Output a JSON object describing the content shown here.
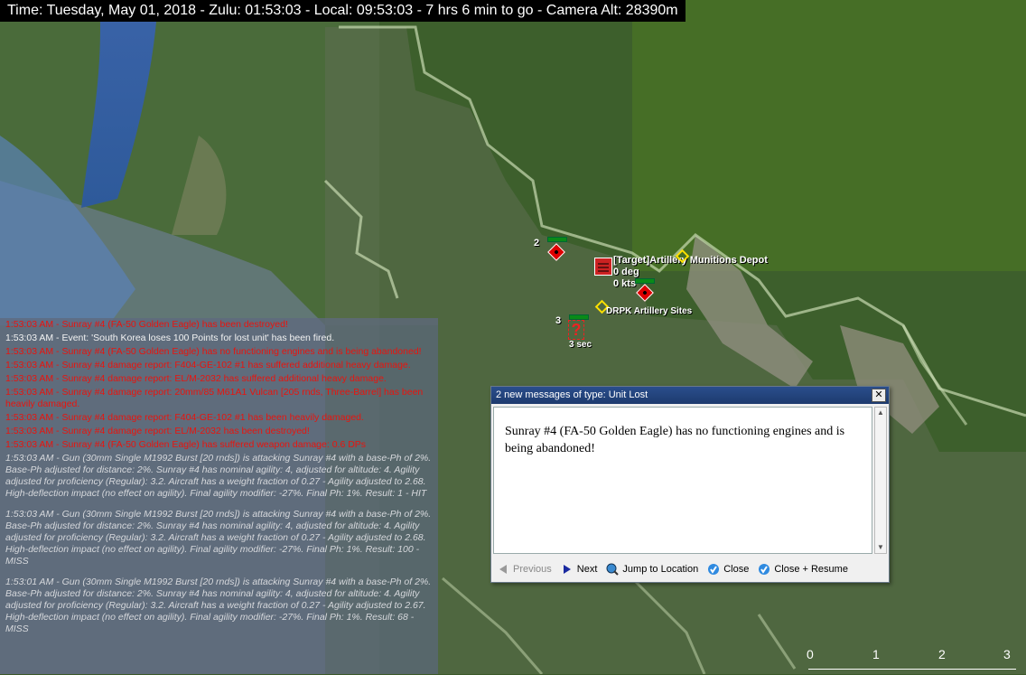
{
  "status_bar": {
    "text": "Time: Tuesday, May 01, 2018 - Zulu: 01:53:03 - Local: 09:53:03 - 7 hrs 6 min to go -  Camera Alt: 28390m"
  },
  "map": {
    "units": [
      {
        "label": "2"
      },
      {
        "label": "3"
      }
    ],
    "target_label": "[Target]Artillery Munitions Depot",
    "target_heading": "0 deg",
    "target_speed": "0 kts",
    "site_label": "DRPK Artillery Sites",
    "timer_label": "3 sec"
  },
  "log": {
    "entries": [
      {
        "color": "red",
        "text": "1:53:03 AM - Sunray #4 (FA-50 Golden Eagle) has been destroyed!"
      },
      {
        "color": "white",
        "text": "1:53:03 AM - Event: 'South Korea loses 100 Points for lost unit' has been fired."
      },
      {
        "color": "red",
        "text": "1:53:03 AM - Sunray #4 (FA-50 Golden Eagle) has no functioning engines and is being abandoned!"
      },
      {
        "color": "red",
        "text": "1:53:03 AM - Sunray #4 damage report: F404-GE-102 #1 has suffered additional heavy damage."
      },
      {
        "color": "red",
        "text": "1:53:03 AM - Sunray #4 damage report: EL/M-2032 has suffered additional heavy damage."
      },
      {
        "color": "red",
        "text": "1:53:03 AM - Sunray #4 damage report: 20mm/85 M61A1 Vulcan [205 rnds, Three-Barrel] has been heavily damaged."
      },
      {
        "color": "red",
        "text": "1:53:03 AM - Sunray #4 damage report: F404-GE-102 #1 has been heavily damaged."
      },
      {
        "color": "red",
        "text": "1:53:03 AM - Sunray #4 damage report: EL/M-2032 has been destroyed!"
      },
      {
        "color": "red",
        "text": "1:53:03 AM - Sunray #4 (FA-50 Golden Eagle) has suffered weapon damage: 0.6 DPs"
      },
      {
        "color": "grey",
        "text": "1:53:03 AM - Gun (30mm Single M1992 Burst [20 rnds]) is attacking Sunray #4 with a base-Ph of 2%. Base-Ph adjusted for distance: 2%. Sunray #4 has nominal agility: 4, adjusted for altitude: 4. Agility adjusted for proficiency (Regular): 3.2. Aircraft has a weight fraction of 0.27 - Agility adjusted to 2.68. High-deflection impact (no effect on agility). Final agility modifier: -27%. Final Ph: 1%. Result: 1 - HIT"
      },
      {
        "color": "grey",
        "text": "1:53:03 AM - Gun (30mm Single M1992 Burst [20 rnds]) is attacking Sunray #4 with a base-Ph of 2%. Base-Ph adjusted for distance: 2%. Sunray #4 has nominal agility: 4, adjusted for altitude: 4. Agility adjusted for proficiency (Regular): 3.2. Aircraft has a weight fraction of 0.27 - Agility adjusted to 2.68. High-deflection impact (no effect on agility). Final agility modifier: -27%. Final Ph: 1%. Result: 100 - MISS"
      },
      {
        "color": "grey",
        "text": "1:53:01 AM - Gun (30mm Single M1992 Burst [20 rnds]) is attacking Sunray #4 with a base-Ph of 2%. Base-Ph adjusted for distance: 2%. Sunray #4 has nominal agility: 4, adjusted for altitude: 4. Agility adjusted for proficiency (Regular): 3.2. Aircraft has a weight fraction of 0.27 - Agility adjusted to 2.67. High-deflection impact (no effect on agility). Final agility modifier: -27%. Final Ph: 1%. Result: 68 - MISS"
      }
    ]
  },
  "dialog": {
    "title": "2 new messages of type: Unit Lost",
    "close_glyph": "✕",
    "message": "Sunray #4 (FA-50 Golden Eagle) has no functioning engines and is being abandoned!",
    "buttons": {
      "previous": "Previous",
      "next": "Next",
      "jump": "Jump to Location",
      "close": "Close",
      "close_resume": "Close + Resume"
    }
  },
  "scale_bar": {
    "labels": [
      "0",
      "1",
      "2",
      "3"
    ]
  },
  "colors": {
    "hostile": "#dd0000",
    "site_marker": "#ffe000",
    "log_red": "#e8140e",
    "dialog_title": "#1d3a6e"
  }
}
